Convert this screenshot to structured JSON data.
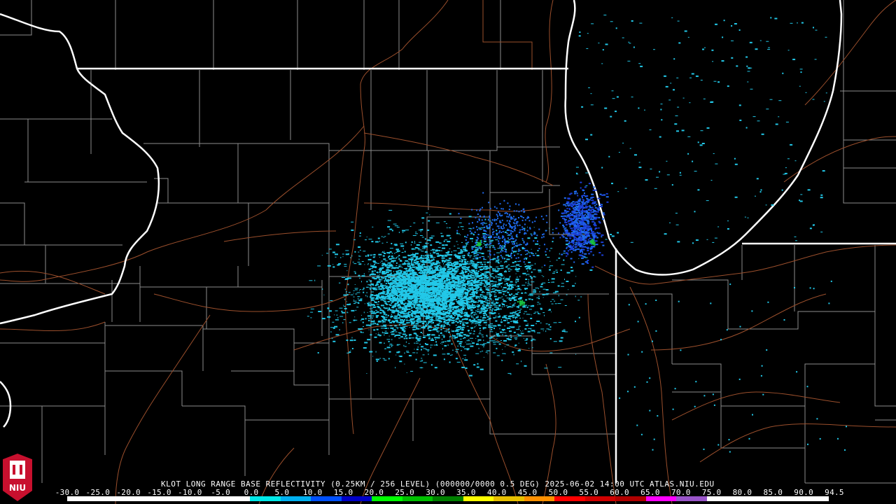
{
  "product": {
    "caption": "KLOT LONG RANGE BASE REFLECTIVITY (0.25KM / 256 LEVEL) (000000/0000 0.5 DEG) 2025-06-02 14:00 UTC  ATLAS.NIU.EDU"
  },
  "legend": {
    "ticks": [
      "-30.0",
      "-25.0",
      "-20.0",
      "-15.0",
      "-10.0",
      "-5.0",
      "0.0",
      "5.0",
      "10.0",
      "15.0",
      "20.0",
      "25.0",
      "30.0",
      "35.0",
      "40.0",
      "45.0",
      "50.0",
      "55.0",
      "60.0",
      "65.0",
      "70.0",
      "75.0",
      "80.0",
      "85.0",
      "90.0",
      "94.5"
    ],
    "colors": [
      "#ffffff",
      "#ffffff",
      "#ffffff",
      "#ffffff",
      "#ffffff",
      "#ffffff",
      "#00e8e8",
      "#00b0f0",
      "#0050ff",
      "#0000c8",
      "#00ff00",
      "#00c000",
      "#008000",
      "#ffff00",
      "#e8c000",
      "#ff9000",
      "#ff0000",
      "#d00000",
      "#b00000",
      "#ff00ff",
      "#9955c9",
      "#ffffff",
      "#ffffff",
      "#ffffff",
      "#ffffff"
    ]
  },
  "logo": {
    "text": "NIU"
  },
  "colors": {
    "background": "#000000",
    "state_border": "#ffffff",
    "county_border": "#8c8c8c",
    "roads": "#9b4f2c",
    "echo_light": "#22c8e8",
    "echo_medium": "#1f6cf0",
    "echo_heavy": "#1b3fd8",
    "echo_green": "#18c040"
  }
}
